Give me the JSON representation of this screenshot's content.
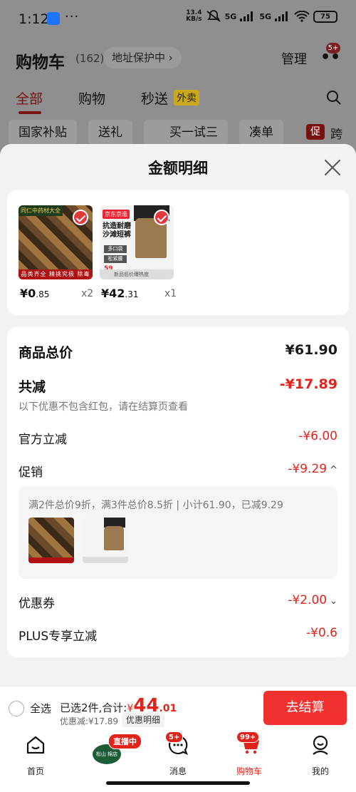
{
  "status_bar": {
    "time": "1:12",
    "more": "···",
    "net_speed_top": "13.4",
    "net_speed_bottom": "KB/s",
    "net_label_1": "5G",
    "net_label_2": "5G",
    "battery": "75"
  },
  "background_page": {
    "title": "购物车",
    "count": "(162)",
    "address_protection": "地址保护中 ›",
    "manage": "管理",
    "more_badge": "5+",
    "tabs": [
      "全部",
      "购物",
      "秒送"
    ],
    "takeout_tag": "外卖",
    "chips": [
      "国家补贴",
      "送礼",
      "买一试三",
      "凑单"
    ],
    "promo_chip_icon": "促",
    "promo_chip_text": "跨"
  },
  "sheet": {
    "title": "金额明细",
    "items": [
      {
        "thumb_corner": "同仁中药材大全",
        "thumb_bottom": "品类齐全  精挑究极  除毒量超",
        "price_int": "¥0",
        "price_dec": ".85",
        "qty": "x2"
      },
      {
        "thumb_brand": "京东京造",
        "thumb_copy_1": "抗造耐磨",
        "thumb_copy_2": "沙滩短裤",
        "thumb_tag_1": "多口袋",
        "thumb_tag_2": "松紧腰",
        "thumb_foot": "新品低价爆热度",
        "thumb_price": "59",
        "price_int": "¥42",
        "price_dec": ".31",
        "qty": "x1"
      }
    ],
    "total_label": "商品总价",
    "total_value": "¥61.90",
    "reduce_label": "共减",
    "reduce_value": "-¥17.89",
    "reduce_note": "以下优惠不包含红包，请在结算页查看",
    "official_label": "官方立减",
    "official_value": "-¥6.00",
    "promo_label": "促销",
    "promo_value": "-¥9.29",
    "promo_chevron": "^",
    "promo_desc": "满2件总价9折，满3件总价8.5折 | 小计61.90，已减9.29",
    "coupon_label": "优惠券",
    "coupon_value": "-¥2.00",
    "coupon_chevron": "⌄",
    "plus_label": "PLUS专享立减",
    "plus_value": "-¥0.6"
  },
  "checkout": {
    "select_all": "全选",
    "summary_prefix": "已选2件,合计:",
    "currency": "¥",
    "total_int": "44",
    "total_dec": ".01",
    "discount_line": "优惠减:¥17.89",
    "detail_button": "优惠明细",
    "checkout_button": "去结算"
  },
  "tabbar": {
    "items": [
      {
        "label": "首页",
        "icon": "home-icon"
      },
      {
        "label": "",
        "icon": "live-shop-icon",
        "badge": "直播中",
        "shop": "松山 棉店"
      },
      {
        "label": "消息",
        "icon": "message-icon",
        "badge": "5+"
      },
      {
        "label": "购物车",
        "icon": "cart-icon",
        "badge": "99+"
      },
      {
        "label": "我的",
        "icon": "profile-icon"
      }
    ]
  },
  "colors": {
    "accent": "#e2231a",
    "checkout_button": "#f0312f"
  }
}
